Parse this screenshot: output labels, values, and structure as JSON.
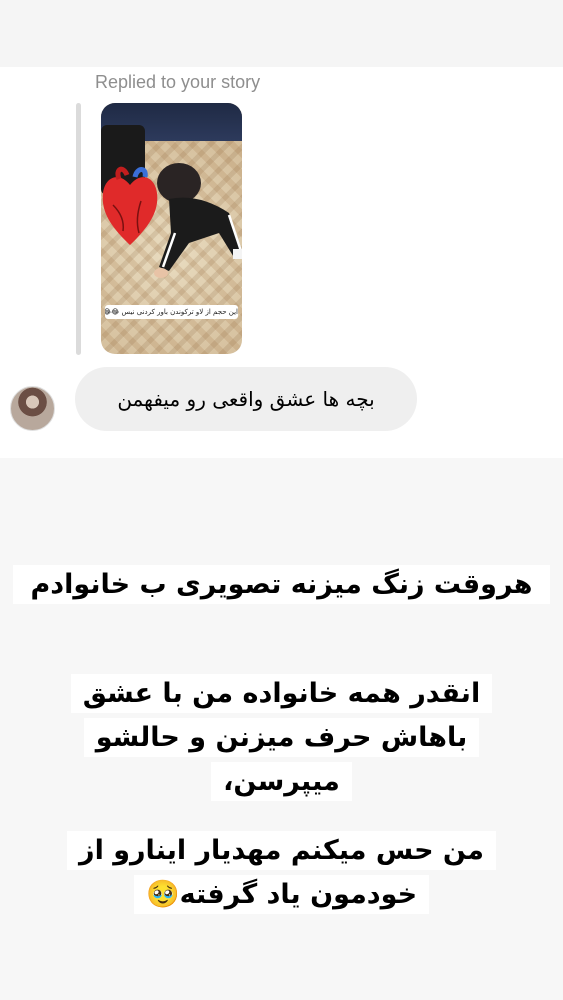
{
  "reply": {
    "label": "Replied to your story"
  },
  "story": {
    "caption": "این حجم از لاو ترکوندن باور کردنی نیس 😂😂"
  },
  "message": {
    "text": "بچه ها عشق واقعی رو میفهمن"
  },
  "story_text": {
    "paragraph_1": "هروقت زنگ میزنه تصویری ب خانوادم",
    "paragraph_2": "انقدر همه خانواده من با عشق باهاش حرف میزنن و حالشو میپرسن،",
    "paragraph_3": "من حس میکنم مهدیار اینارو از خودمون یاد گرفته🥹"
  }
}
